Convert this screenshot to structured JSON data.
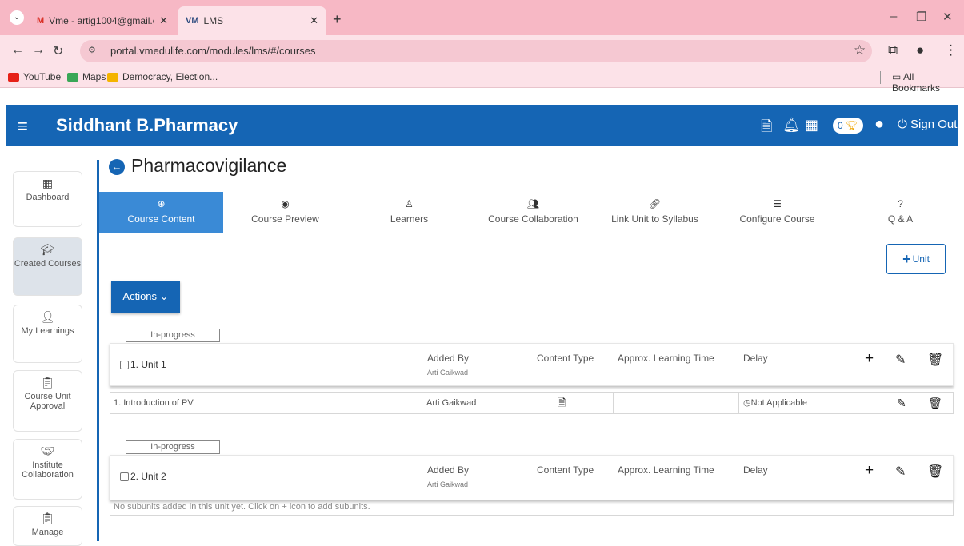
{
  "browser": {
    "tabs": [
      {
        "title": "Vme - artig1004@gmail.com - ",
        "active": false
      },
      {
        "title": "LMS",
        "active": true
      }
    ],
    "new_tab": "+",
    "url": "portal.vmedulife.com/modules/lms/#/courses",
    "bookmarks": [
      "YouTube",
      "Maps",
      "Democracy, Election..."
    ],
    "all_bookmarks": "All Bookmarks"
  },
  "header": {
    "title": "Siddhant B.Pharmacy",
    "trophy_count": "0",
    "sign_out": "Sign Out"
  },
  "sidebar": {
    "items": [
      {
        "label": "Dashboard",
        "icon": "grid-icon",
        "selected": false
      },
      {
        "label": "Created Courses",
        "icon": "graduation-cap-icon",
        "selected": true
      },
      {
        "label": "My Learnings",
        "icon": "reader-icon",
        "selected": false
      },
      {
        "label": "Course Unit Approval",
        "icon": "clipboard-check-icon",
        "selected": false
      },
      {
        "label": "Institute Collaboration",
        "icon": "handshake-icon",
        "selected": false
      },
      {
        "label": "Manage",
        "icon": "clipboard-icon",
        "selected": false
      }
    ]
  },
  "page": {
    "title": "Pharmacovigilance",
    "tabs": [
      {
        "label": "Course Content",
        "icon": "plus-circle-icon",
        "active": true
      },
      {
        "label": "Course Preview",
        "icon": "eye-icon",
        "active": false
      },
      {
        "label": "Learners",
        "icon": "user-icon",
        "active": false
      },
      {
        "label": "Course Collaboration",
        "icon": "users-icon",
        "active": false
      },
      {
        "label": "Link Unit to Syllabus",
        "icon": "link-icon",
        "active": false
      },
      {
        "label": "Configure Course",
        "icon": "sliders-icon",
        "active": false
      },
      {
        "label": "Q & A",
        "icon": "question-icon",
        "active": false
      }
    ],
    "add_unit": "Unit",
    "actions": "Actions",
    "columns": {
      "added_by": "Added By",
      "content_type": "Content Type",
      "learning_time": "Approx. Learning Time",
      "delay": "Delay"
    },
    "units": [
      {
        "status": "In-progress",
        "name": "1. Unit 1",
        "added_by": "Arti Gaikwad",
        "subunits": [
          {
            "name": "1. Introduction of PV",
            "added_by": "Arti Gaikwad",
            "content_type_icon": "file-icon",
            "learning_time": "",
            "delay": "Not Applicable"
          }
        ]
      },
      {
        "status": "In-progress",
        "name": "2. Unit 2",
        "added_by": "Arti Gaikwad",
        "empty_message": "No subunits added in this unit yet. Click on + icon to add subunits."
      }
    ]
  }
}
